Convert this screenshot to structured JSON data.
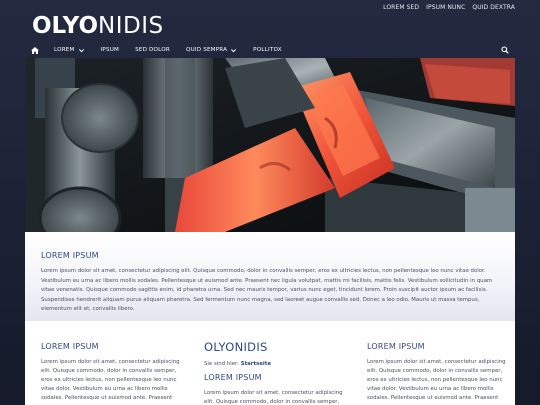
{
  "top_links": [
    "LOREM SED",
    "IPSUM NUNC",
    "QUID DEXTRA"
  ],
  "logo": {
    "bold": "OLYO",
    "thin": "NIDIS"
  },
  "nav": {
    "items": [
      {
        "label": "LOREM",
        "has_dropdown": true
      },
      {
        "label": "IPSUM",
        "has_dropdown": false
      },
      {
        "label": "SED DOLOR",
        "has_dropdown": false
      },
      {
        "label": "QUID SEMPRA",
        "has_dropdown": true
      },
      {
        "label": "POLLITOX",
        "has_dropdown": false
      }
    ]
  },
  "intro": {
    "heading": "LOREM IPSUM",
    "text": "Lorem ipsum dolor sit amet, consectetur adipiscing elit. Quisque commodo, dolor in convallis semper, eros ex ultricies lectus, non pellentesque leo nunc vitae dolor. Vestibulum eu urna ac libero mollis sodales. Pellentesque ut euismod ante. Praesent nec ligula volutpat, mattis mi facilisis, mattis felis. Vestibulum sollicitudin in quam vitae venenatis. Quisque commodo sagittis enim, id pharetra urna. Sed nec mauris tempor, varius nunc eget, tincidunt lorem. Proin suscipit auctor ipsum ac facilisis. Suspendisse hendrerit aliquam purus aliquam pharetra. Sed fermentum nunc magna, sed laoreet augue convallis sed. Donec a leo odio. Mauris ut massa tempus, elementum elit et, convallis libero."
  },
  "columns": {
    "left": {
      "heading": "LOREM IPSUM",
      "text": "Lorem ipsum dolor sit amet, consectetur adipiscing elit. Quisque commodo, dolor in convallis semper, eros ex ultricies lectus, non pellentesque leo nunc vitae dolor. Vestibulum eu urna ac libero mollis sodales. Pellentesque ut euismod ante. Praesent nec"
    },
    "middle": {
      "title": "OLYONIDIS",
      "crumb_label": "Sie sind hier:",
      "crumb_link": "Startseite",
      "heading": "LOREM IPSUM",
      "text": "Lorem ipsum dolor sit amet, consectetur adipiscing elit. Quisque commodo, dolor in convallis semper,"
    },
    "right": {
      "heading": "LOREM IPSUM",
      "text": "Lorem ipsum dolor sit amet, consectetur adipiscing elit. Quisque commodo, dolor in convallis semper, eros ex ultricies lectus, non pellentesque leo nunc vitae dolor. Vestibulum eu urna ac libero mollis sodales. Pellentesque ut euismod ante. Praesent nec"
    }
  },
  "colors": {
    "background": "#1b2133",
    "accent_blue": "#2e4a86",
    "body_text": "#4a4f60"
  },
  "hero_image": "forged-hot-steel-bars"
}
